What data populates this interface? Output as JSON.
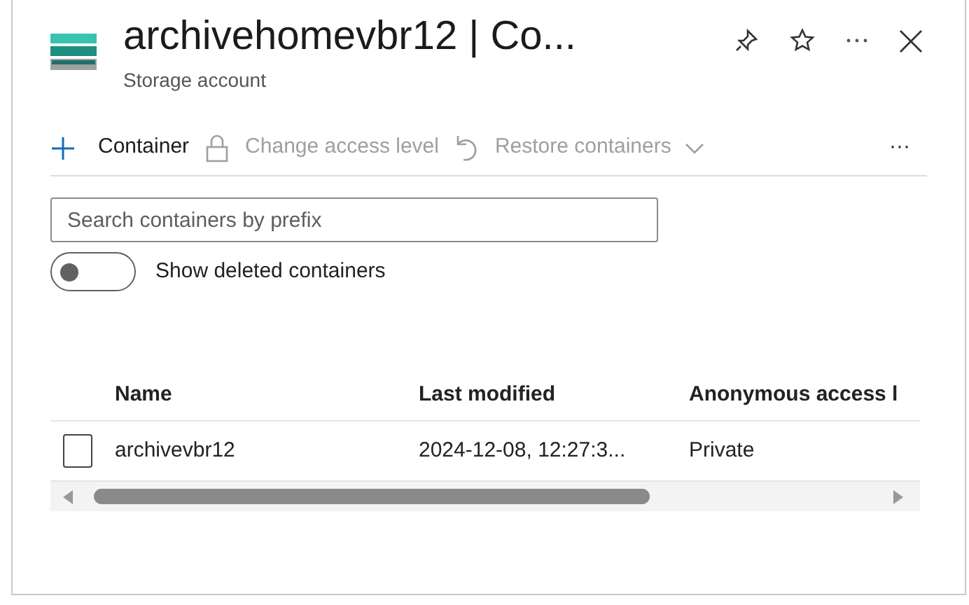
{
  "header": {
    "title": "archivehomevbr12 | Co...",
    "subtitle": "Storage account"
  },
  "toolbar": [
    {
      "kind": "add",
      "label": "Container",
      "disabled": false
    },
    {
      "kind": "lock",
      "label": "Change access level",
      "disabled": true
    },
    {
      "kind": "restore",
      "label": "Restore containers",
      "disabled": true
    },
    {
      "kind": "more",
      "label": "···",
      "disabled": false
    }
  ],
  "search": {
    "placeholder": "Search containers by prefix"
  },
  "toggle": {
    "label": "Show deleted containers",
    "on": false
  },
  "table": {
    "columns": [
      "Name",
      "Last modified",
      "Anonymous access l"
    ],
    "rows": [
      {
        "checked": false,
        "cells": [
          "archivevbr12",
          "2024-12-08, 12:27:3...",
          "Private"
        ]
      }
    ]
  }
}
